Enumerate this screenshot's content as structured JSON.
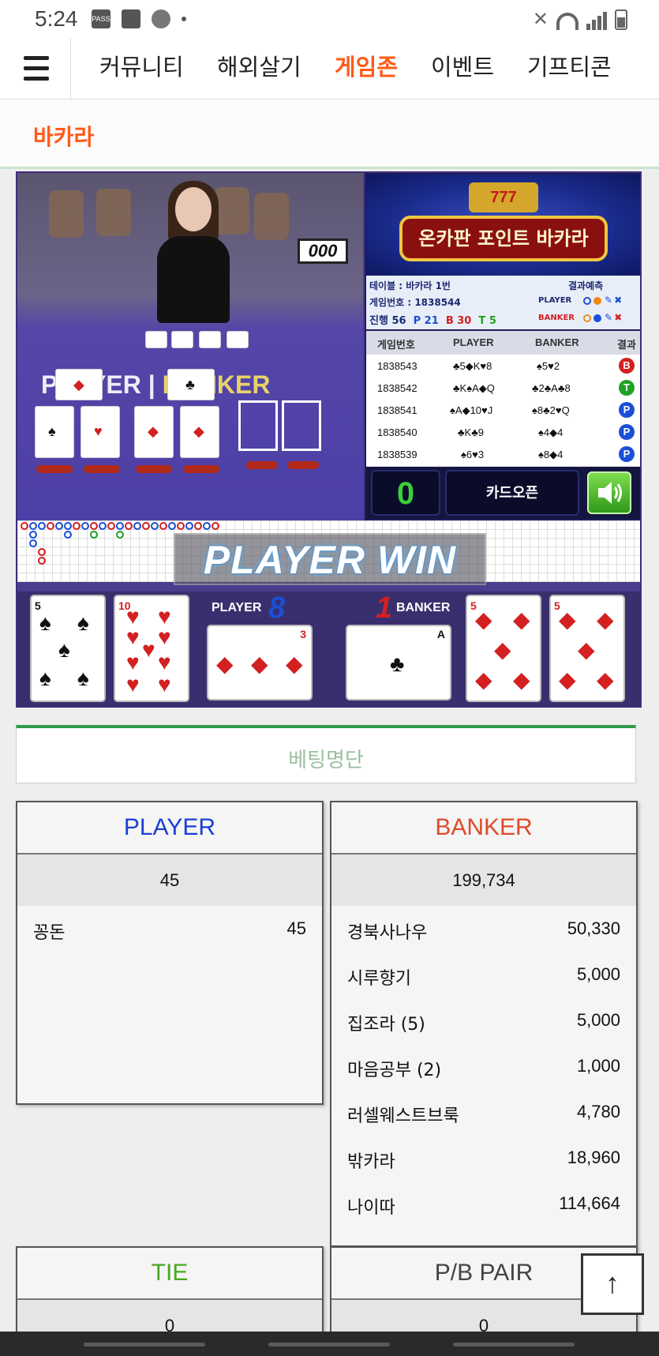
{
  "status_bar": {
    "time": "5:24",
    "icons": [
      "pass-icon",
      "image-icon",
      "accessibility-icon",
      "dot-icon",
      "mute-icon",
      "wifi-icon",
      "signal-icon",
      "battery-icon"
    ],
    "pass_label": "PASS"
  },
  "nav": {
    "menu_icon": "hamburger-icon",
    "tabs": [
      {
        "label": "커뮤니티",
        "active": false
      },
      {
        "label": "해외살기",
        "active": false
      },
      {
        "label": "게임존",
        "active": true
      },
      {
        "label": "이벤트",
        "active": false
      },
      {
        "label": "기프티콘",
        "active": false
      }
    ]
  },
  "section": {
    "title": "바카라"
  },
  "game": {
    "shoe_counter": "000",
    "table_player_label": "PLAYER",
    "table_banker_label": "BANKER",
    "logo": {
      "slot": "777",
      "title": "온카판 포인트 바카라"
    },
    "info": {
      "table": "테이블 : 바카라 1번",
      "prediction_label": "결과예측",
      "game_no": "게임번호 : 1838544",
      "player_label": "PLAYER",
      "banker_label": "BANKER",
      "progress": "진행 56",
      "p_count": "P 21",
      "b_count": "B 30",
      "t_count": "T 5"
    },
    "history": {
      "headers": [
        "게임번호",
        "PLAYER",
        "BANKER",
        "결과"
      ],
      "rows": [
        {
          "no": "1838543",
          "player": "♣5◆K♥8",
          "banker": "♠5♥2",
          "result": "B",
          "color": "#d42020"
        },
        {
          "no": "1838542",
          "player": "♣K♠A◆Q",
          "banker": "♣2♣A♣8",
          "result": "T",
          "color": "#22a022"
        },
        {
          "no": "1838541",
          "player": "♠A◆10♥J",
          "banker": "♠8♣2♥Q",
          "result": "P",
          "color": "#1a4fd6"
        },
        {
          "no": "1838540",
          "player": "♣K♣9",
          "banker": "♠4◆4",
          "result": "P",
          "color": "#1a4fd6"
        },
        {
          "no": "1838539",
          "player": "♠6♥3",
          "banker": "♠8◆4",
          "result": "P",
          "color": "#1a4fd6"
        }
      ]
    },
    "counter": "0",
    "card_open": "카드오픈",
    "sound_icon": "speaker-icon",
    "win_banner": "PLAYER WIN",
    "player_score_label": "PLAYER",
    "player_score": "8",
    "banker_score_label": "BANKER",
    "banker_score": "1",
    "result_cards": [
      {
        "rank": "5",
        "suit": "♠",
        "color": "#111"
      },
      {
        "rank": "10",
        "suit": "♥",
        "color": "#d42020"
      },
      {
        "rank": "3",
        "suit": "◆",
        "color": "#d42020"
      },
      {
        "rank": "A",
        "suit": "♣",
        "color": "#111"
      },
      {
        "rank": "5",
        "suit": "◆",
        "color": "#d42020"
      },
      {
        "rank": "5",
        "suit": "◆",
        "color": "#d42020"
      }
    ]
  },
  "betting": {
    "title": "베팅명단",
    "player": {
      "label": "PLAYER",
      "color": "#1a3fd6",
      "total": "45",
      "rows": [
        {
          "name": "꽁돈",
          "amount": "45"
        }
      ]
    },
    "banker": {
      "label": "BANKER",
      "color": "#e04a2a",
      "total": "199,734",
      "rows": [
        {
          "name": "경북사나우",
          "amount": "50,330"
        },
        {
          "name": "시루향기",
          "amount": "5,000"
        },
        {
          "name": "집조라 (5)",
          "amount": "5,000"
        },
        {
          "name": "마음공부 (2)",
          "amount": "1,000"
        },
        {
          "name": "러셀웨스트브룩",
          "amount": "4,780"
        },
        {
          "name": "밖카라",
          "amount": "18,960"
        },
        {
          "name": "나이따",
          "amount": "114,664"
        }
      ]
    },
    "tie": {
      "label": "TIE",
      "color": "#4aa820",
      "total": "0"
    },
    "pair": {
      "label": "P/B PAIR",
      "color": "#444444",
      "total": "0"
    }
  },
  "scroll_top_icon": "arrow-up-icon",
  "scroll_top_label": "↑"
}
